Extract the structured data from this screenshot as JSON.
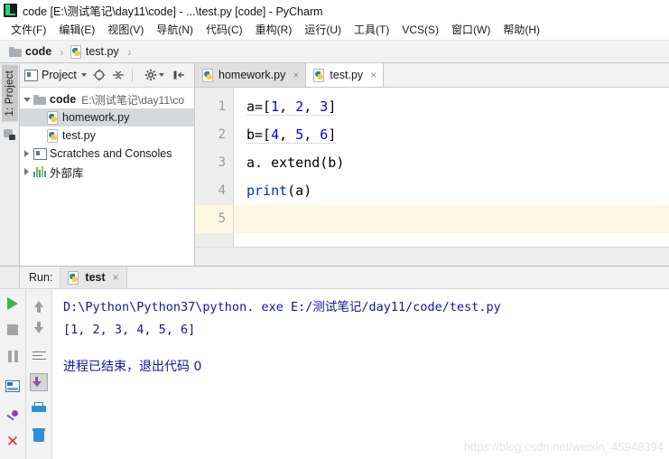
{
  "window": {
    "title": "code [E:\\测试笔记\\day11\\code] - ...\\test.py [code] - PyCharm",
    "logo": "pycharm-logo"
  },
  "menubar": {
    "items": [
      {
        "label": "文件(F)"
      },
      {
        "label": "编辑(E)"
      },
      {
        "label": "视图(V)"
      },
      {
        "label": "导航(N)"
      },
      {
        "label": "代码(C)"
      },
      {
        "label": "重构(R)"
      },
      {
        "label": "运行(U)"
      },
      {
        "label": "工具(T)"
      },
      {
        "label": "VCS(S)"
      },
      {
        "label": "窗口(W)"
      },
      {
        "label": "帮助(H)"
      }
    ]
  },
  "breadcrumb": {
    "items": [
      {
        "label": "code",
        "icon": "folder-icon"
      },
      {
        "label": "test.py",
        "icon": "python-file-icon"
      }
    ],
    "separator": "›"
  },
  "toolstrip": {
    "project_tab": "1: Project",
    "structure_icon": "structure-icon"
  },
  "project_panel": {
    "header_title": "Project",
    "icons": [
      "project-view-icon",
      "caret-down-icon",
      "locate-icon",
      "collapse-all-icon",
      "gear-icon",
      "hide-panel-icon"
    ],
    "tree": [
      {
        "label": "code",
        "sub": "E:\\测试笔记\\day11\\co",
        "icon": "folder-icon",
        "expanded": true,
        "indent": 0,
        "selected": false
      },
      {
        "label": "homework.py",
        "sub": "",
        "icon": "python-file-icon",
        "expanded": null,
        "indent": 2,
        "selected": true
      },
      {
        "label": "test.py",
        "sub": "",
        "icon": "python-file-icon",
        "expanded": null,
        "indent": 2,
        "selected": false
      },
      {
        "label": "Scratches and Consoles",
        "sub": "",
        "icon": "module-icon",
        "expanded": false,
        "indent": 0,
        "selected": false
      },
      {
        "label": "外部库",
        "sub": "",
        "icon": "library-icon",
        "expanded": false,
        "indent": 0,
        "selected": false
      }
    ]
  },
  "editor": {
    "tabs": [
      {
        "label": "homework.py",
        "icon": "python-file-icon",
        "active": false,
        "close": "×"
      },
      {
        "label": "test.py",
        "icon": "python-file-icon",
        "active": true,
        "close": "×"
      }
    ],
    "line_numbers": [
      "1",
      "2",
      "3",
      "4",
      "5"
    ],
    "current_line": 5,
    "lines": [
      {
        "n": "1",
        "parts": [
          {
            "t": "a=[",
            "k": "plain"
          },
          {
            "t": "1",
            "k": "num"
          },
          {
            "t": ", ",
            "k": "plain"
          },
          {
            "t": "2",
            "k": "num"
          },
          {
            "t": ", ",
            "k": "plain"
          },
          {
            "t": "3",
            "k": "num"
          },
          {
            "t": "]",
            "k": "plain"
          }
        ]
      },
      {
        "n": "2",
        "parts": [
          {
            "t": "b=[",
            "k": "plain"
          },
          {
            "t": "4",
            "k": "num"
          },
          {
            "t": ", ",
            "k": "plain"
          },
          {
            "t": "5",
            "k": "num"
          },
          {
            "t": ", ",
            "k": "plain"
          },
          {
            "t": "6",
            "k": "num"
          },
          {
            "t": "]",
            "k": "plain"
          }
        ]
      },
      {
        "n": "3",
        "parts": [
          {
            "t": "a. extend(b)",
            "k": "plain"
          }
        ]
      },
      {
        "n": "4",
        "parts": [
          {
            "t": "print",
            "k": "kw"
          },
          {
            "t": "(a)",
            "k": "plain"
          }
        ]
      },
      {
        "n": "5",
        "parts": [
          {
            "t": "",
            "k": "plain"
          }
        ]
      }
    ],
    "code_text": {
      "line1": "a=[1, 2, 3]",
      "line2": "b=[4, 5, 6]",
      "line3": "a. extend(b)",
      "line4": "print(a)",
      "line5": ""
    }
  },
  "run_window": {
    "label": "Run:",
    "tab": {
      "label": "test",
      "icon": "python-file-icon",
      "close": "×"
    },
    "left_tools": [
      {
        "name": "rerun-button",
        "icon": "play-icon"
      },
      {
        "name": "stop-button",
        "icon": "stop-icon"
      },
      {
        "name": "pause-button",
        "icon": "pause-icon"
      },
      {
        "name": "show-console-button",
        "icon": "console-icon"
      },
      {
        "name": "pin-tab-button",
        "icon": "pin-icon"
      },
      {
        "name": "close-run-button",
        "icon": "close-x-icon"
      }
    ],
    "right_tools": [
      {
        "name": "up-stack-button",
        "icon": "arrow-up-icon"
      },
      {
        "name": "down-stack-button",
        "icon": "arrow-down-icon"
      },
      {
        "name": "soft-wrap-button",
        "icon": "wrap-lines-icon"
      },
      {
        "name": "scroll-to-end-button",
        "icon": "scroll-to-end-icon",
        "selected": true
      },
      {
        "name": "print-button",
        "icon": "printer-icon"
      },
      {
        "name": "clear-all-button",
        "icon": "trash-icon"
      }
    ],
    "console": {
      "command": "D:\\Python\\Python37\\python. exe E:/测试笔记/day11/code/test.py",
      "output": "[1, 2, 3, 4, 5, 6]",
      "exit_message": "进程已结束，退出代码 0"
    }
  },
  "watermark": {
    "text": "https://blog.csdn.net/weixin_45948394"
  },
  "colors": {
    "accent_green": "#3cb34a",
    "number_blue": "#0000ee",
    "keyword_blue": "#0033b3",
    "console_blue": "#15159e",
    "current_line": "#fdf6e0",
    "selection_grey": "#d6d9dc"
  }
}
